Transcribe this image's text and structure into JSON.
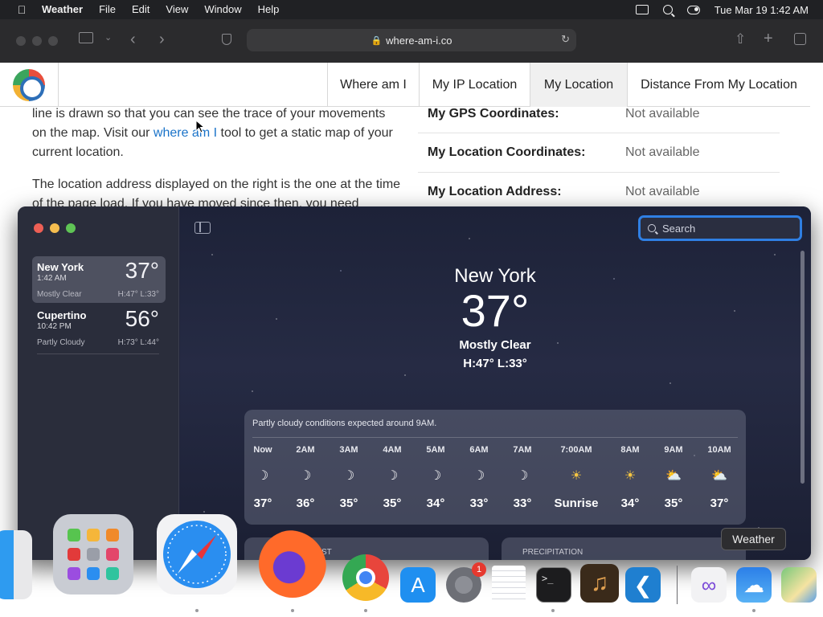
{
  "menubar": {
    "app_name": "Weather",
    "items": [
      "File",
      "Edit",
      "View",
      "Window",
      "Help"
    ],
    "clock": "Tue Mar 19  1:42 AM"
  },
  "browser": {
    "url": "where-am-i.co"
  },
  "site": {
    "nav": [
      "Where am I",
      "My IP Location",
      "My Location",
      "Distance From My Location"
    ],
    "active_nav": "My Location",
    "article": {
      "p1_before": "line is drawn so that you can see the trace of your movements on the map. Visit our ",
      "p1_link": "where am I",
      "p1_after": " tool to get a static map of your current location.",
      "p2": "The location address displayed on the right is the one at the time of the page load. If you have moved since then, you need"
    },
    "info_rows": [
      {
        "label": "My GPS Coordinates:",
        "value": "Not available"
      },
      {
        "label": "My Location Coordinates:",
        "value": "Not available"
      },
      {
        "label": "My Location Address:",
        "value": "Not available"
      }
    ]
  },
  "weather": {
    "search_placeholder": "Search",
    "cities": [
      {
        "name": "New York",
        "time": "1:42 AM",
        "temp": "37°",
        "condition": "Mostly Clear",
        "hl": "H:47°  L:33°"
      },
      {
        "name": "Cupertino",
        "time": "10:42 PM",
        "temp": "56°",
        "condition": "Partly Cloudy",
        "hl": "H:73°  L:44°"
      }
    ],
    "hero": {
      "city": "New York",
      "temp": "37°",
      "condition": "Mostly Clear",
      "hl": "H:47°  L:33°"
    },
    "hourly_summary": "Partly cloudy conditions expected around 9AM.",
    "hourly": [
      {
        "hour": "Now",
        "icon": "moon-icon",
        "temp": "37°"
      },
      {
        "hour": "2AM",
        "icon": "moon-icon",
        "temp": "36°"
      },
      {
        "hour": "3AM",
        "icon": "moon-icon",
        "temp": "35°"
      },
      {
        "hour": "4AM",
        "icon": "moon-icon",
        "temp": "35°"
      },
      {
        "hour": "5AM",
        "icon": "moon-icon",
        "temp": "34°"
      },
      {
        "hour": "6AM",
        "icon": "moon-icon",
        "temp": "33°"
      },
      {
        "hour": "7AM",
        "icon": "moon-icon",
        "temp": "33°"
      },
      {
        "hour": "7:00AM",
        "icon": "sunrise-icon",
        "temp": "Sunrise"
      },
      {
        "hour": "8AM",
        "icon": "sun-icon",
        "temp": "34°"
      },
      {
        "hour": "9AM",
        "icon": "partly-cloudy-icon",
        "temp": "35°"
      },
      {
        "hour": "10AM",
        "icon": "partly-cloudy-icon",
        "temp": "37°"
      }
    ],
    "precipitation_label": "PRECIPITATION",
    "forecast_label_fragment": "ST"
  },
  "tooltip": "Weather",
  "dock": {
    "settings_badge": "1"
  }
}
